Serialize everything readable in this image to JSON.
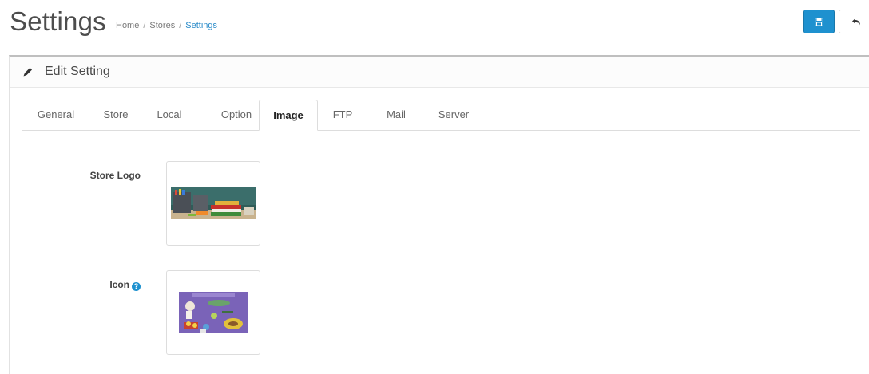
{
  "header": {
    "title": "Settings",
    "breadcrumb": [
      {
        "label": "Home"
      },
      {
        "label": "Stores"
      },
      {
        "label": "Settings",
        "active": true
      }
    ],
    "save_icon": "save-icon",
    "back_icon": "reply-icon",
    "accent_color": "#1e91cf"
  },
  "panel": {
    "title": "Edit Setting",
    "title_icon": "pencil-icon"
  },
  "tabs": [
    {
      "label": "General"
    },
    {
      "label": "Store"
    },
    {
      "label": "Local"
    },
    {
      "label": "Option"
    },
    {
      "label": "Image",
      "active": true
    },
    {
      "label": "FTP"
    },
    {
      "label": "Mail"
    },
    {
      "label": "Server"
    }
  ],
  "fields": {
    "store_logo": {
      "label": "Store Logo"
    },
    "icon": {
      "label": "Icon",
      "help_icon": "question-circle-icon",
      "help_glyph": "?"
    }
  }
}
